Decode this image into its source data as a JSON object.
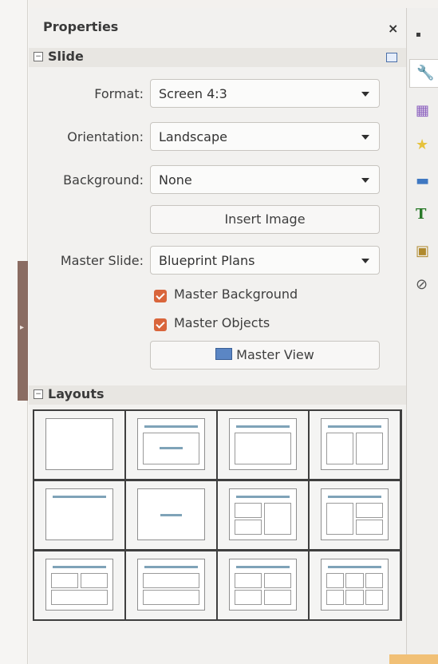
{
  "panel": {
    "title": "Properties",
    "close_glyph": "×"
  },
  "slide_section": {
    "label": "Slide",
    "format_label": "Format:",
    "format_value": "Screen 4:3",
    "orientation_label": "Orientation:",
    "orientation_value": "Landscape",
    "background_label": "Background:",
    "background_value": "None",
    "insert_image_label": "Insert Image",
    "master_slide_label": "Master Slide:",
    "master_slide_value": "Blueprint Plans",
    "master_background_label": "Master Background",
    "master_background_checked": true,
    "master_objects_label": "Master Objects",
    "master_objects_checked": true,
    "master_view_label": "Master View"
  },
  "layouts_section": {
    "label": "Layouts"
  },
  "tabs": [
    {
      "icon": "wrench-icon",
      "glyph": "🔧"
    },
    {
      "icon": "slide-transition-icon",
      "glyph": "▦"
    },
    {
      "icon": "animation-star-icon",
      "glyph": "★"
    },
    {
      "icon": "master-pages-icon",
      "glyph": "▬"
    },
    {
      "icon": "styles-icon",
      "glyph": "T"
    },
    {
      "icon": "gallery-icon",
      "glyph": "▣"
    },
    {
      "icon": "navigator-icon",
      "glyph": "⊘"
    }
  ],
  "colors": {
    "accent_check": "#d9653b",
    "layout_bar": "#7fa3b8",
    "grip": "#8a6c62"
  }
}
